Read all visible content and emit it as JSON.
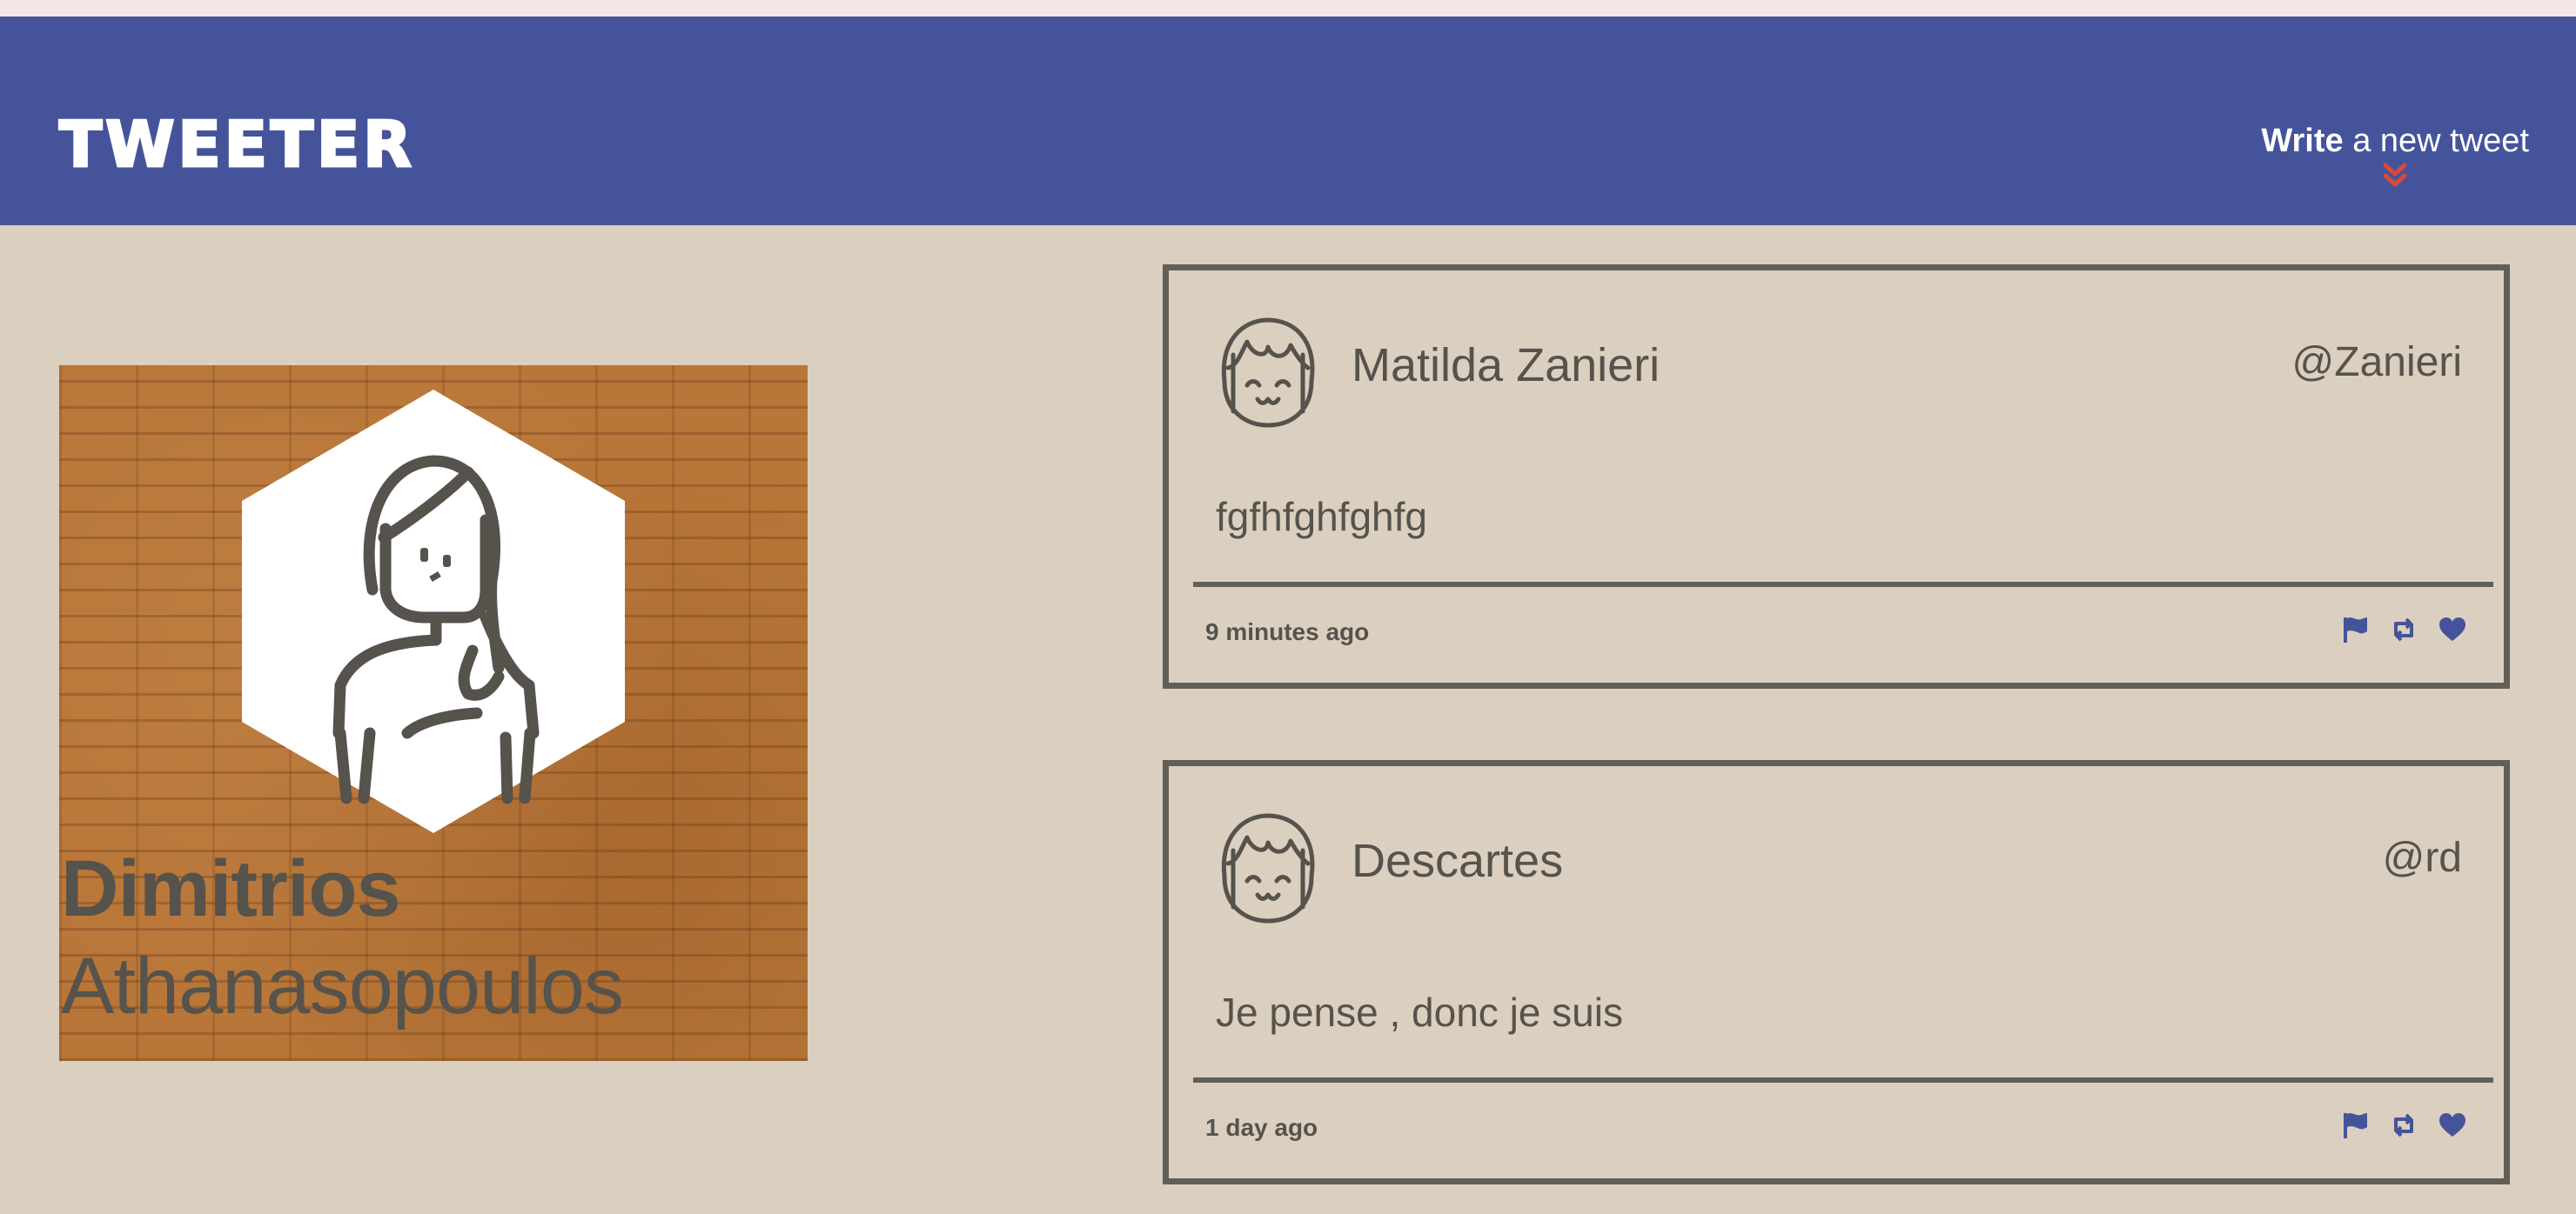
{
  "header": {
    "brand": "TWEETER",
    "compose_bold": "Write",
    "compose_rest": " a new tweet"
  },
  "profile": {
    "first_name": "Dimitrios",
    "last_name": "Athanasopoulos"
  },
  "tweets": [
    {
      "name": "Matilda Zanieri",
      "handle": "@Zanieri",
      "content": "fgfhfghfghfg",
      "time": "9 minutes ago"
    },
    {
      "name": "Descartes",
      "handle": "@rd",
      "content": "Je pense , donc je suis",
      "time": "1 day ago"
    }
  ],
  "icons": {
    "flag": "flag-icon",
    "retweet": "retweet-icon",
    "like": "heart-icon",
    "compose_arrow": "double-chevron-down-icon"
  },
  "colors": {
    "navbar": "#45549a",
    "page_background": "#dbcfbf",
    "text": "#56524c",
    "accent_red": "#d84a3a",
    "icon_blue": "#45549a"
  }
}
